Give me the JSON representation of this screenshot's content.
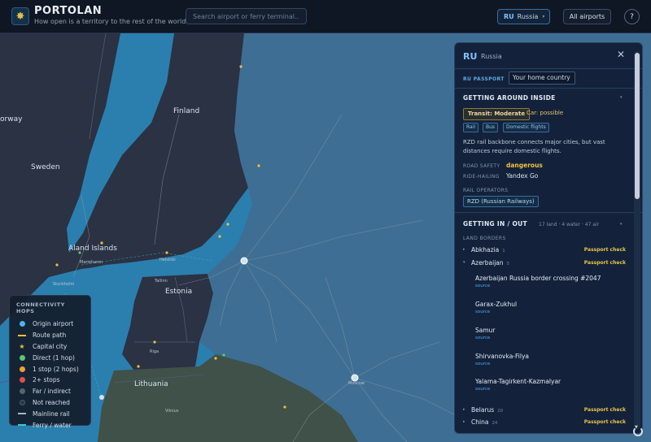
{
  "header": {
    "brand_title": "PORTOLAN",
    "brand_subtitle": "How open is a territory to the rest of the world?",
    "search_placeholder": "Search airport or ferry terminal... (",
    "country_code": "RU",
    "country_name": "Russia",
    "all_airports_label": "All airports",
    "help_label": "?"
  },
  "map": {
    "labels": [
      "Finland",
      "Sweden",
      "Aland Islands",
      "Estonia",
      "Lithuania",
      "orway",
      "Mariehamn",
      "Stockholm",
      "Helsinki",
      "Tallinn",
      "Riga",
      "Vilnius",
      "Moscow"
    ]
  },
  "legend": {
    "title": "CONNECTIVITY HOPS",
    "items": [
      {
        "label": "Origin airport",
        "kind": "dot",
        "color": "#4eb4f0"
      },
      {
        "label": "Route path",
        "kind": "line",
        "color": "#f0c040"
      },
      {
        "label": "Capital city",
        "kind": "star",
        "color": "#f0c040"
      },
      {
        "label": "Direct (1 hop)",
        "kind": "dot",
        "color": "#5cc870"
      },
      {
        "label": "1 stop (2 hops)",
        "kind": "dot",
        "color": "#f0a030"
      },
      {
        "label": "2+ stops",
        "kind": "dot",
        "color": "#e05050"
      },
      {
        "label": "Far / indirect",
        "kind": "dot",
        "color": "#56656e"
      },
      {
        "label": "Not reached",
        "kind": "dot",
        "color": "#2a3646"
      },
      {
        "label": "Mainline rail",
        "kind": "line",
        "color": "#aab6c4"
      },
      {
        "label": "Ferry / water",
        "kind": "line",
        "color": "#36c8d8"
      }
    ]
  },
  "panel": {
    "code": "RU",
    "name": "Russia",
    "close_label": "✕",
    "passport_label": "RU PASSPORT",
    "passport_value": "Your home country",
    "getting_around": {
      "title": "GETTING AROUND INSIDE",
      "transit": "Transit: Moderate",
      "car": "Car: possible",
      "tags": [
        "Rail",
        "Bus",
        "Domestic flights"
      ],
      "description": "RZD rail backbone connects major cities, but vast distances require domestic flights.",
      "road_safety_label": "ROAD SAFETY",
      "road_safety_value": "dangerous",
      "ride_hailing_label": "RIDE-HAILING",
      "ride_hailing_value": "Yandex Go",
      "rail_operators_label": "RAIL OPERATORS",
      "rail_operator": "RZD (Russian Railways)"
    },
    "getting_in_out": {
      "title": "GETTING IN / OUT",
      "meta": "17 land · 4 water · 47 air",
      "land_borders_label": "LAND BORDERS",
      "borders": [
        {
          "name": "Abkhazia",
          "count": "1",
          "check": "Passport check",
          "caret": "▸"
        },
        {
          "name": "Azerbaijan",
          "count": "5",
          "check": "Passport check",
          "caret": "▾"
        }
      ],
      "crossings": [
        {
          "name": "Azerbaijan Russia border crossing #2047",
          "source": "source"
        },
        {
          "name": "Garax-Zukhul",
          "source": "source"
        },
        {
          "name": "Samur",
          "source": "source"
        },
        {
          "name": "Shirvanovka-Filya",
          "source": "source"
        },
        {
          "name": "Yalama-Tagirkent-Kazmalyar",
          "source": "source"
        }
      ],
      "more_borders": [
        {
          "name": "Belarus",
          "count": "20",
          "check": "Passport check",
          "caret": "▸"
        },
        {
          "name": "China",
          "count": "24",
          "check": "Passport check",
          "caret": "▸"
        }
      ]
    }
  }
}
